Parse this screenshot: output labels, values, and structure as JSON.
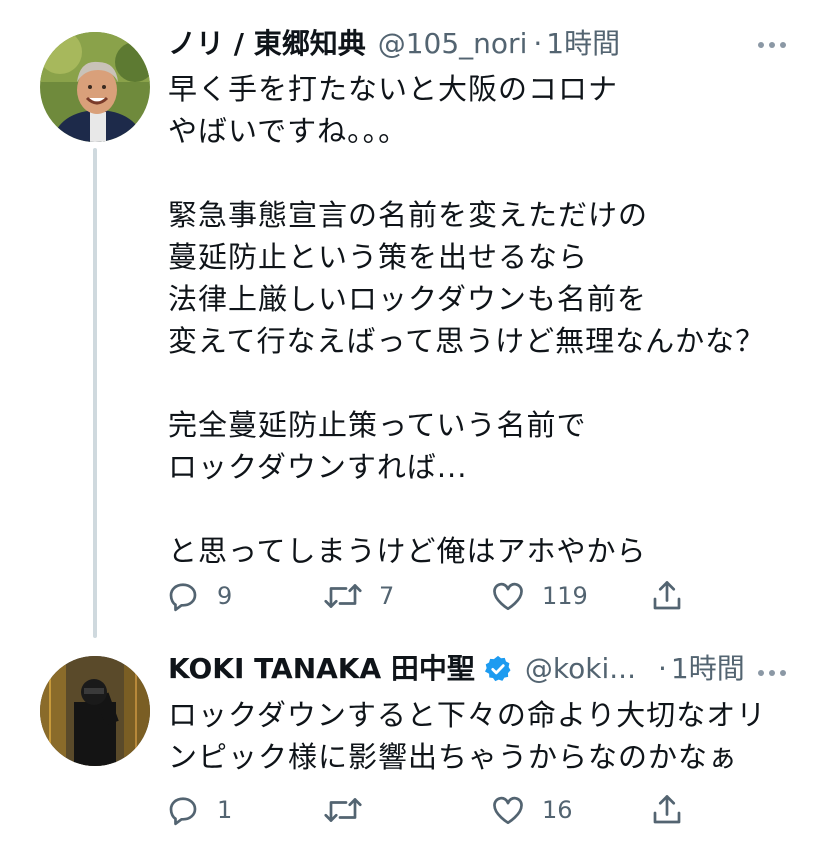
{
  "tweets": [
    {
      "name": "ノリ / 東郷知典",
      "handle": "@105_nori",
      "separator": "·",
      "time": "1時間",
      "verified": false,
      "text": "早く手を打たないと大阪のコロナ\nやばいですね。。。\n\n緊急事態宣言の名前を変えただけの\n蔓延防止という策を出せるなら\n法律上厳しいロックダウンも名前を\n変えて行なえばって思うけど無理なんかな？\n\n完全蔓延防止策っていう名前で\nロックダウンすれば...\n\nと思ってしまうけど俺はアホやから",
      "replies": "9",
      "retweets": "7",
      "likes": "119"
    },
    {
      "name": "KOKI TANAKA 田中聖",
      "handle": "@koki...",
      "separator": "·",
      "time": "1時間",
      "verified": true,
      "text": "ロックダウンすると下々の命より大切なオリ\nンピック様に影響出ちゃうからなのかなぁ",
      "replies": "1",
      "retweets": "",
      "likes": "16"
    }
  ],
  "icons": {
    "reply": "reply-icon",
    "retweet": "retweet-icon",
    "like": "heart-icon",
    "share": "share-icon",
    "more": "more-icon",
    "verified": "verified-badge-icon"
  },
  "colors": {
    "text": "#0f1419",
    "secondary": "#536471",
    "verified": "#1d9bf0",
    "thread_line": "#cfd9de"
  }
}
